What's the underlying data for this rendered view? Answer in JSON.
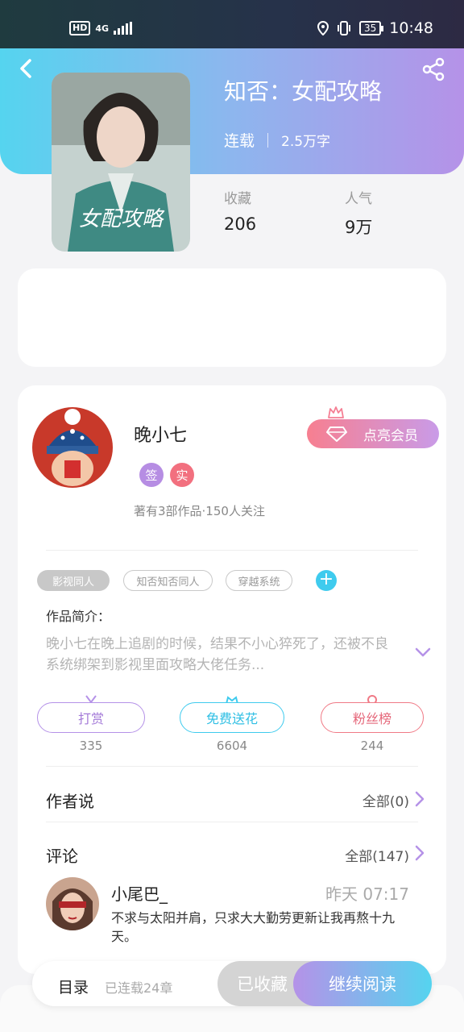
{
  "status_bar": {
    "hd": "HD",
    "network": "4G",
    "battery": "35",
    "time": "10:48"
  },
  "header": {
    "back_icon": "chevron-left-icon",
    "share_icon": "share-icon"
  },
  "book": {
    "title": "知否：女配攻略",
    "status": "连载",
    "word_count": "2.5万字",
    "cover_text": "女配攻略",
    "stats": [
      {
        "label": "收藏",
        "value": "206"
      },
      {
        "label": "人气",
        "value": "9万"
      }
    ]
  },
  "author": {
    "name": "晚小七",
    "badges": [
      "签",
      "实"
    ],
    "works_info": "著有3部作品·150人关注",
    "vip_label": "点亮会员"
  },
  "tags": {
    "items": [
      "影视同人",
      "知否知否同人",
      "穿越系统"
    ],
    "add": "+"
  },
  "intro": {
    "label": "作品简介：",
    "text": "晚小七在晚上追剧的时候，结果不小心猝死了，还被不良系统绑架到影视里面攻略大佬任务..."
  },
  "actions": [
    {
      "label": "打赏",
      "count": "335"
    },
    {
      "label": "免费送花",
      "count": "6604"
    },
    {
      "label": "粉丝榜",
      "count": "244"
    }
  ],
  "author_says": {
    "title": "作者说",
    "link": "全部(0)"
  },
  "comments": {
    "title": "评论",
    "link": "全部(147)",
    "items": [
      {
        "user": "小尾巴_",
        "time": "昨天 07:17",
        "text": "不求与太阳并肩，只求大大勤劳更新让我再熬十九天。"
      }
    ]
  },
  "bottom_bar": {
    "toc": "目录",
    "serial": "已连载24章",
    "collected": "已收藏",
    "read": "继续阅读"
  },
  "colors": {
    "accent_cyan": "#55d4ef",
    "accent_purple": "#b592e8",
    "accent_pink": "#f77f90"
  }
}
